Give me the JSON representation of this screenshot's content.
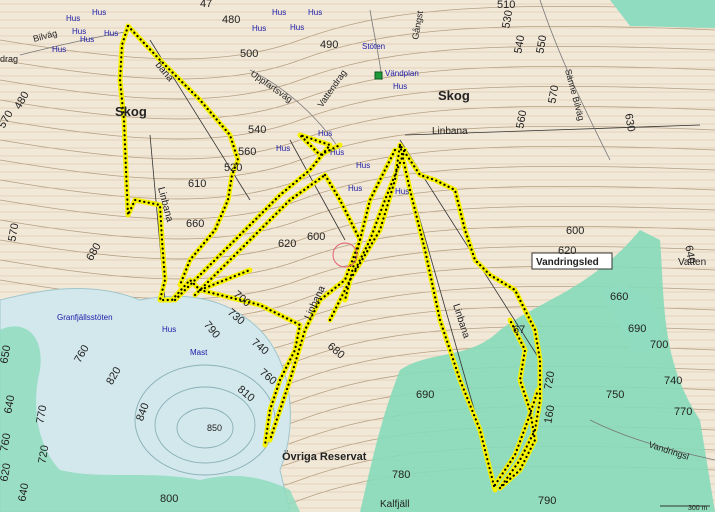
{
  "map": {
    "colors": {
      "background": "#f2e8d8",
      "contour": "#b09a7a",
      "forest_green": "#7dd9b5",
      "open_land": "#cfe5e8",
      "track": "#f5f000",
      "track_dots": "#000000",
      "building_label": "#1a1aa8"
    },
    "place_names": {
      "skog_west": "Skog",
      "skog_north": "Skog",
      "ovriga_reservat": "Övriga Reservat",
      "kalfjall": "Kalfjäll",
      "granfjallsstoten": "Granfjällsstöten",
      "stoten": "Stöten",
      "mast": "Mast"
    },
    "roads": {
      "bilvag_west": "Bilväg",
      "drag_west": "drag",
      "uppfartsvag": "Uppfartsväg",
      "vattendrag": "Vattendrag",
      "gangstig": "Gångst",
      "sanne_bilvag": "Sänne Bilväg",
      "vandringsled_box": "Vandringsled",
      "vandringsled_se": "Vandringsl",
      "vatten_e": "Vatten",
      "vandplan": "Vändplan"
    },
    "lifts": {
      "linbana_west": "Linbana",
      "linbana_mid": "Linbana",
      "linbana_center": "Linbana",
      "linbana_north": "Linbana",
      "linbana_top": "bana"
    },
    "buildings": {
      "hus": "Hus"
    },
    "contours": {
      "c470": "47",
      "c480a": "480",
      "c480b": "480",
      "c500": "500",
      "c490": "490",
      "c510": "510",
      "c530": "530",
      "c540a": "540",
      "c550": "550",
      "c570a": "570",
      "c560a": "560",
      "c630": "630",
      "c540b": "540",
      "c560b": "560",
      "c520": "520",
      "c610": "610",
      "c660a": "660",
      "c620a": "620",
      "c600a": "600",
      "c600b": "600",
      "c620b": "620",
      "c640": "640",
      "c570b": "570",
      "c680a": "680",
      "c660b": "660",
      "c690a": "690",
      "c700a": "700",
      "c730": "730",
      "c790": "790",
      "c740a": "740",
      "c680b": "680",
      "c760a": "760",
      "c650": "650",
      "c760b": "760",
      "c820": "820",
      "c810": "810",
      "c760c": "760",
      "c700b": "700",
      "c740b": "740",
      "c750": "750",
      "c690b": "690",
      "c720a": "720",
      "c770a": "770",
      "c640b": "640",
      "c840": "840",
      "c850": "850",
      "c770b": "770",
      "c760d": "760",
      "c720b": "720",
      "c620c": "620",
      "c640c": "640",
      "c800": "800",
      "c780": "780",
      "c790b": "790",
      "c160": "160",
      "c670": "67"
    },
    "scale_label": "300 m"
  }
}
